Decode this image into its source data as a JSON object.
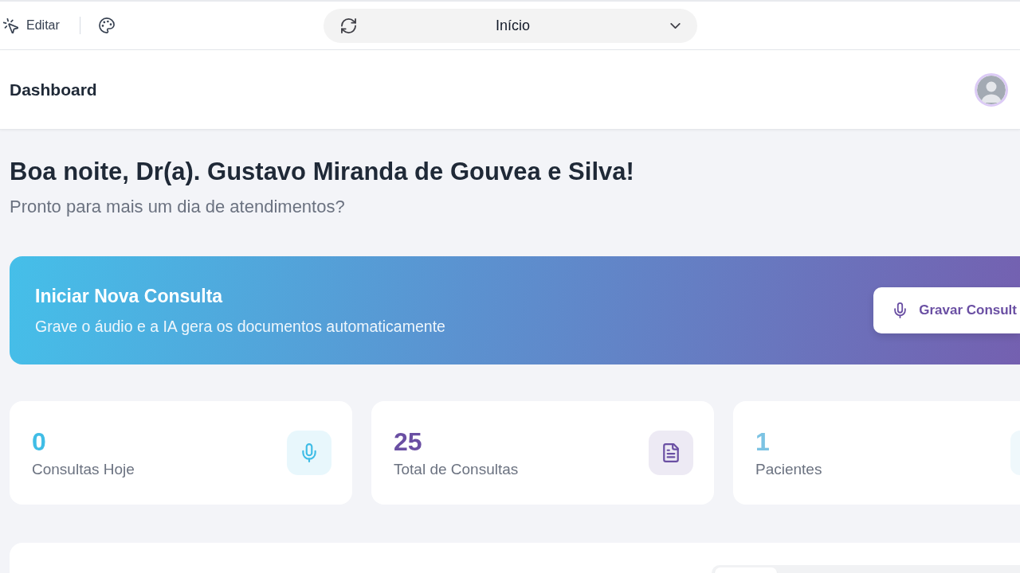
{
  "toolbar": {
    "edit_button": {
      "label": "Editar"
    },
    "page_select": {
      "value": "Início"
    }
  },
  "header": {
    "title": "Dashboard"
  },
  "greeting": {
    "title": "Boa noite, Dr(a). Gustavo Miranda de Gouvea e Silva!",
    "subtitle": "Pronto para mais um dia de atendimentos?"
  },
  "banner": {
    "title": "Iniciar Nova Consulta",
    "subtitle": "Grave o áudio e a IA gera os documentos automaticamente",
    "button": "Gravar Consult"
  },
  "stats": [
    {
      "kind": "recordings",
      "value": "0",
      "label": "Consultas Hoje",
      "color": "#40bde6"
    },
    {
      "kind": "documents",
      "value": "25",
      "label": "Total de Consultas",
      "color": "#6a4fa3"
    },
    {
      "kind": "patients",
      "value": "1",
      "label": "Pacientes",
      "color": "#7cc3e3"
    }
  ]
}
